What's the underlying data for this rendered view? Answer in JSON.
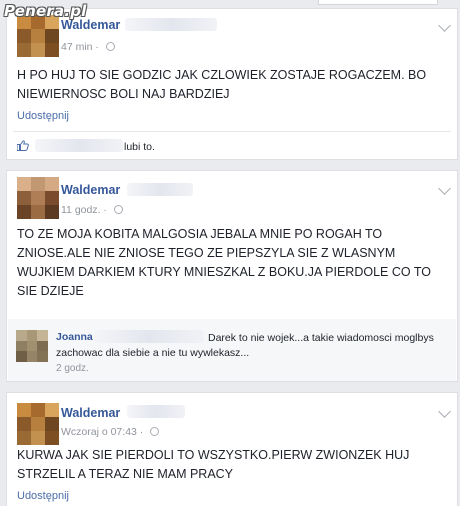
{
  "watermark": "Penera.pl",
  "posts": [
    {
      "author": "Waldemar",
      "time": "47 min · ",
      "text": "H PO HUJ TO SIE GODZIC JAK CZLOWIEK ZOSTAJE ROGACZEM. BO NIEWIERNOSC BOLI NAJ BARDZIEJ",
      "share_label": "Udostępnij",
      "likes_text": "lubi to."
    },
    {
      "author": "Waldemar",
      "time": "11 godz. · ",
      "text": "TO ZE MOJA KOBITA MALGOSIA JEBALA MNIE PO ROGAH TO ZNIOSE.ALE NIE ZNIOSE TEGO ZE PIEPSZYLA SIE Z WLASNYM WUJKIEM DARKIEM KTURY MNIESZKAL Z BOKU.JA PIERDOLE CO TO SIE DZIEJE",
      "comment": {
        "author": "Joanna",
        "text_line1": "Darek to nie wojek...a takie wiadomosci moglbys",
        "text_line2": "zachowac dla siebie a nie tu wywlekasz...",
        "time": "2 godz."
      }
    },
    {
      "author": "Waldemar",
      "time": "Wczoraj o 07:43 · ",
      "text": "KURWA JAK SIE PIERDOLI TO WSZYSTKO.PIERW ZWIONZEK HUJ STRZELIL A TERAZ NIE MAM PRACY",
      "share_label": "Udostępnij"
    }
  ],
  "colors": {
    "link": "#365899",
    "share": "#4b6ea9",
    "meta": "#90949c",
    "background": "#e9ebee",
    "avatar_palette": [
      "#c98b3f",
      "#a66a2e",
      "#7d4e22",
      "#d9a45c",
      "#b7803f",
      "#8b5a2b",
      "#6e4620",
      "#9a6a35",
      "#c2904f"
    ]
  },
  "icons": {
    "like": "thumbs-up-icon",
    "audience": "globe-icon",
    "menu": "chevron-down-icon"
  }
}
